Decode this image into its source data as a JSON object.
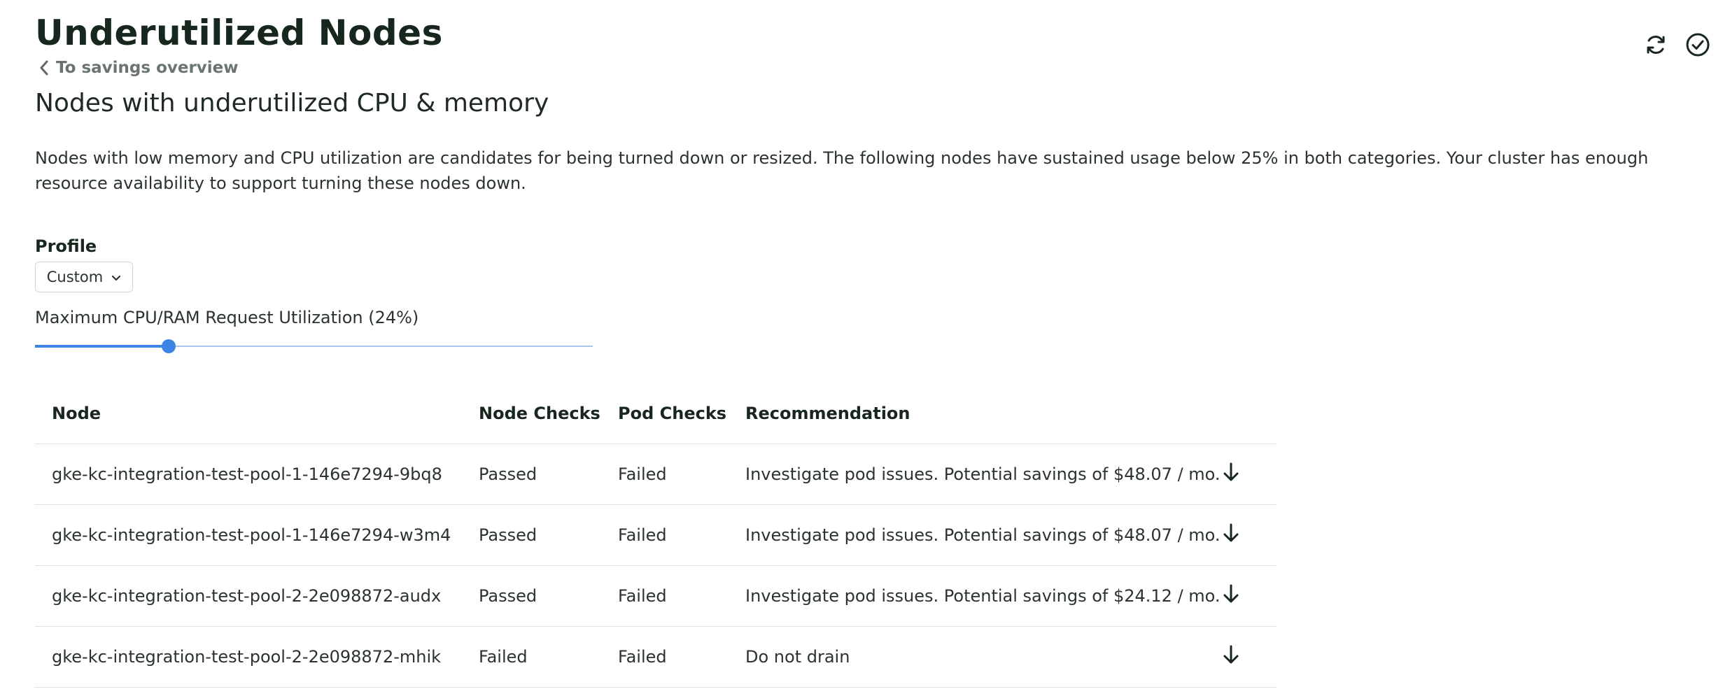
{
  "page": {
    "title": "Underutilized Nodes",
    "back_link": "To savings overview",
    "subtitle": "Nodes with underutilized CPU & memory",
    "description": "Nodes with low memory and CPU utilization are candidates for being turned down or resized. The following nodes have sustained usage below 25% in both categories. Your cluster has enough resource availability to support turning these nodes down."
  },
  "actions": {
    "refresh_icon": "refresh-icon",
    "confirm_icon": "check-circle-icon"
  },
  "profile": {
    "label": "Profile",
    "selected": "Custom"
  },
  "slider": {
    "label": "Maximum CPU/RAM Request Utilization (24%)",
    "value_percent": 24
  },
  "table": {
    "columns": [
      "Node",
      "Node Checks",
      "Pod Checks",
      "Recommendation"
    ],
    "rows": [
      {
        "node": "gke-kc-integration-test-pool-1-146e7294-9bq8",
        "node_checks": "Passed",
        "pod_checks": "Failed",
        "recommendation": "Investigate pod issues. Potential savings of $48.07 / mo."
      },
      {
        "node": "gke-kc-integration-test-pool-1-146e7294-w3m4",
        "node_checks": "Passed",
        "pod_checks": "Failed",
        "recommendation": "Investigate pod issues. Potential savings of $48.07 / mo."
      },
      {
        "node": "gke-kc-integration-test-pool-2-2e098872-audx",
        "node_checks": "Passed",
        "pod_checks": "Failed",
        "recommendation": "Investigate pod issues. Potential savings of $24.12 / mo."
      },
      {
        "node": "gke-kc-integration-test-pool-2-2e098872-mhik",
        "node_checks": "Failed",
        "pod_checks": "Failed",
        "recommendation": "Do not drain"
      }
    ]
  },
  "colors": {
    "accent": "#3d84e6",
    "title": "#17271d",
    "muted": "#6b7570"
  }
}
